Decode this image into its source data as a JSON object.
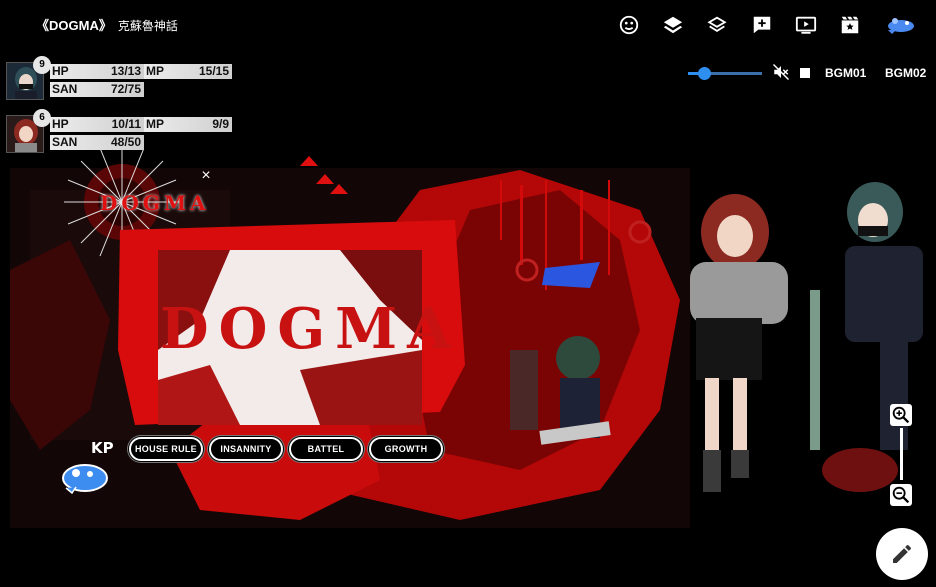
{
  "room": {
    "title": "《DOGMA》",
    "subtitle": "克蘇魯神話"
  },
  "toolbar": {
    "icons": [
      "face-icon",
      "layers-icon",
      "layers-outline-icon",
      "add-note-icon",
      "screen-icon",
      "clapperboard-icon",
      "mascot-icon"
    ]
  },
  "characters": [
    {
      "badge": "9",
      "hp_label": "HP",
      "hp_value": "13/13",
      "mp_label": "MP",
      "mp_value": "15/15",
      "san_label": "SAN",
      "san_value": "72/75"
    },
    {
      "badge": "6",
      "hp_label": "HP",
      "hp_value": "10/11",
      "mp_label": "MP",
      "mp_value": "9/9",
      "san_label": "SAN",
      "san_value": "48/50"
    }
  ],
  "bgm": {
    "volume": 0.22,
    "bgm1": "BGM01",
    "bgm2": "BGM02",
    "accent": "#2f8ff0"
  },
  "card": {
    "logo": "DOGMA",
    "main": "DOGMA",
    "close": "×"
  },
  "kp_label": "KP",
  "buttons": [
    {
      "label": "HOUSE RULE"
    },
    {
      "label": "INSANNITY"
    },
    {
      "label": "BATTEL"
    },
    {
      "label": "GROWTH"
    }
  ],
  "colors": {
    "blood_red": "#d20a0a",
    "background": "#000000"
  }
}
